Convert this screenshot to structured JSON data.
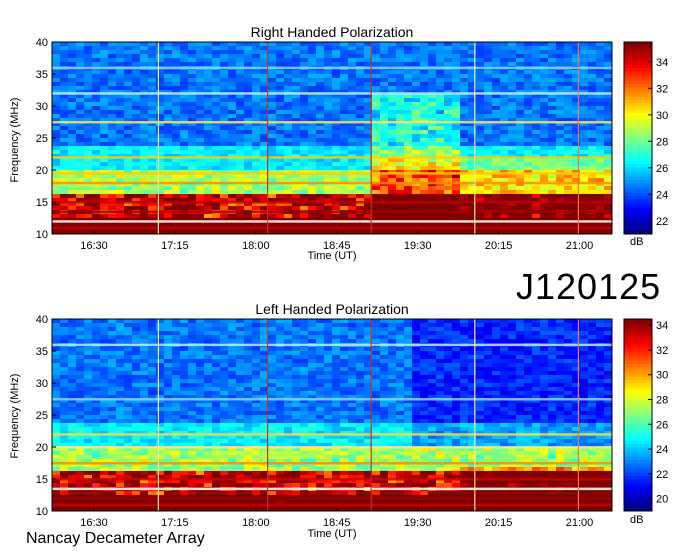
{
  "page": {
    "observation_id": "J120125",
    "footer": "Nancay Decameter Array"
  },
  "chart_data": [
    {
      "type": "heatmap",
      "title": "Right Handed Polarization",
      "xlabel": "Time (UT)",
      "ylabel": "Frequency (MHz)",
      "x_ticks": [
        "16:30",
        "17:15",
        "18:00",
        "18:45",
        "19:30",
        "20:15",
        "21:00"
      ],
      "y_ticks": [
        10,
        15,
        20,
        25,
        30,
        35,
        40
      ],
      "ylim": [
        10,
        40
      ],
      "colorbar": {
        "label": "dB",
        "ticks": [
          22,
          24,
          26,
          28,
          30,
          32,
          34
        ],
        "range": [
          21,
          35.5
        ]
      }
    },
    {
      "type": "heatmap",
      "title": "Left Handed Polarization",
      "xlabel": "Time (UT)",
      "ylabel": "Frequency (MHz)",
      "x_ticks": [
        "16:30",
        "17:15",
        "18:00",
        "18:45",
        "19:30",
        "20:15",
        "21:00"
      ],
      "y_ticks": [
        10,
        15,
        20,
        25,
        30,
        35,
        40
      ],
      "ylim": [
        10,
        40
      ],
      "colorbar": {
        "label": "dB",
        "ticks": [
          20,
          22,
          24,
          26,
          28,
          30,
          32,
          34
        ],
        "range": [
          19,
          34.5
        ]
      }
    }
  ]
}
